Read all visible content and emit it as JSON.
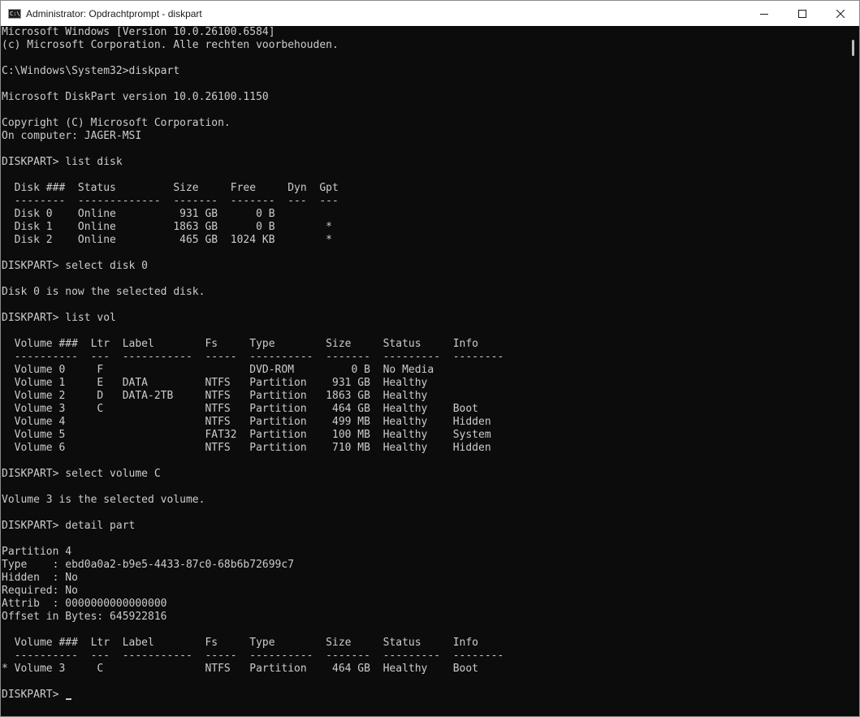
{
  "window": {
    "title": "Administrator: Opdrachtprompt - diskpart",
    "icon_label": "C:\\"
  },
  "controls": {
    "minimize": "minimize-icon",
    "maximize": "maximize-icon",
    "close": "close-icon"
  },
  "console": {
    "lines": [
      "Microsoft Windows [Version 10.0.26100.6584]",
      "(c) Microsoft Corporation. Alle rechten voorbehouden.",
      "",
      "C:\\Windows\\System32>diskpart",
      "",
      "Microsoft DiskPart version 10.0.26100.1150",
      "",
      "Copyright (C) Microsoft Corporation.",
      "On computer: JAGER-MSI",
      "",
      "DISKPART> list disk",
      "",
      "  Disk ###  Status         Size     Free     Dyn  Gpt",
      "  --------  -------------  -------  -------  ---  ---",
      "  Disk 0    Online          931 GB      0 B",
      "  Disk 1    Online         1863 GB      0 B        *",
      "  Disk 2    Online          465 GB  1024 KB        *",
      "",
      "DISKPART> select disk 0",
      "",
      "Disk 0 is now the selected disk.",
      "",
      "DISKPART> list vol",
      "",
      "  Volume ###  Ltr  Label        Fs     Type        Size     Status     Info",
      "  ----------  ---  -----------  -----  ----------  -------  ---------  --------",
      "  Volume 0     F                       DVD-ROM         0 B  No Media",
      "  Volume 1     E   DATA         NTFS   Partition    931 GB  Healthy",
      "  Volume 2     D   DATA-2TB     NTFS   Partition   1863 GB  Healthy",
      "  Volume 3     C                NTFS   Partition    464 GB  Healthy    Boot",
      "  Volume 4                      NTFS   Partition    499 MB  Healthy    Hidden",
      "  Volume 5                      FAT32  Partition    100 MB  Healthy    System",
      "  Volume 6                      NTFS   Partition    710 MB  Healthy    Hidden",
      "",
      "DISKPART> select volume C",
      "",
      "Volume 3 is the selected volume.",
      "",
      "DISKPART> detail part",
      "",
      "Partition 4",
      "Type    : ebd0a0a2-b9e5-4433-87c0-68b6b72699c7",
      "Hidden  : No",
      "Required: No",
      "Attrib  : 0000000000000000",
      "Offset in Bytes: 645922816",
      "",
      "  Volume ###  Ltr  Label        Fs     Type        Size     Status     Info",
      "  ----------  ---  -----------  -----  ----------  -------  ---------  --------",
      "* Volume 3     C                NTFS   Partition    464 GB  Healthy    Boot",
      ""
    ],
    "prompt": "DISKPART> "
  },
  "colors": {
    "console_bg": "#0c0c0c",
    "console_fg": "#cccccc",
    "titlebar_bg": "#ffffff"
  }
}
